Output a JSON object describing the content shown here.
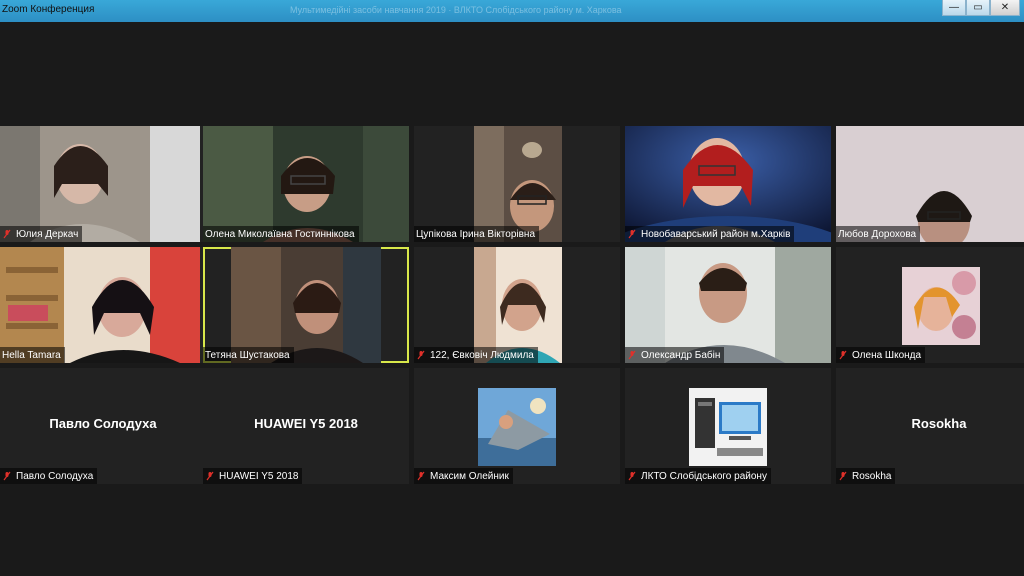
{
  "window": {
    "title": "Zoom Конференция",
    "center_text": "Мультимедійні засоби навчання 2019 · ВЛКТО Слобідського району м. Харкова",
    "buttons": {
      "minimize": "—",
      "maximize": "▭",
      "close": "✕"
    }
  },
  "participants": [
    {
      "name": "Юлия Деркач",
      "muted": true
    },
    {
      "name": "Олена Миколаївна Гостиннікова",
      "muted": false
    },
    {
      "name": "Цупікова Ірина Вікторівна",
      "muted": false
    },
    {
      "name": "Новобаварський район м.Харків",
      "muted": true
    },
    {
      "name": "Любов Дорохова",
      "muted": false
    },
    {
      "name": "Hella Tamara",
      "muted": false
    },
    {
      "name": "Тетяна Шустакова",
      "muted": false,
      "active_speaker": true
    },
    {
      "name": "122, Євковіч Людмила",
      "muted": true
    },
    {
      "name": "Олександр Бабін",
      "muted": true
    },
    {
      "name": "Олена Шконда",
      "muted": true
    },
    {
      "name": "Павло Солодуха",
      "muted": true,
      "display": "Павло Солодуха"
    },
    {
      "name": "HUAWEI Y5 2018",
      "muted": true,
      "display": "HUAWEI Y5 2018"
    },
    {
      "name": "Максим Олейник",
      "muted": true
    },
    {
      "name": "ЛКТО Слобідського району",
      "muted": true
    },
    {
      "name": "Rosokha",
      "muted": true,
      "display": "Rosokha"
    }
  ],
  "colors": {
    "active_border": "#d8e84a",
    "mute_icon": "#e0302a",
    "tile_bg": "#222222"
  }
}
